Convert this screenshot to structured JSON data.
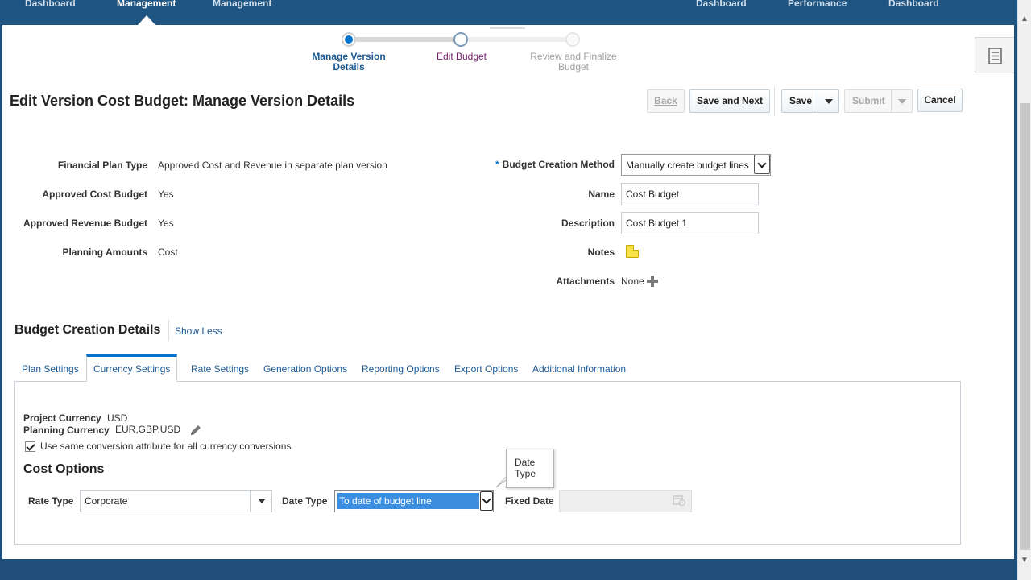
{
  "topnav": {
    "items": [
      "Dashboard",
      "Management",
      "Management",
      "Dashboard",
      "Performance",
      "Dashboard"
    ]
  },
  "train": {
    "stops": [
      {
        "label_line1": "Manage Version",
        "label_line2": "Details",
        "state": "current",
        "color": "#1c5a96"
      },
      {
        "label_line1": "Edit Budget",
        "label_line2": "",
        "state": "next",
        "color": "#7a1e6e"
      },
      {
        "label_line1": "Review and Finalize",
        "label_line2": "Budget",
        "state": "future",
        "color": "#a0a0a0"
      }
    ]
  },
  "page": {
    "title": "Edit Version Cost Budget: Manage Version Details"
  },
  "toolbar": {
    "back_label": "Back",
    "save_next_label": "Save and Next",
    "save_label": "Save",
    "submit_label": "Submit",
    "cancel_label": "Cancel"
  },
  "form_left": {
    "fields": [
      {
        "label": "Financial Plan Type",
        "value": "Approved Cost and Revenue in separate plan version"
      },
      {
        "label": "Approved Cost Budget",
        "value": "Yes"
      },
      {
        "label": "Approved Revenue Budget",
        "value": "Yes"
      },
      {
        "label": "Planning Amounts",
        "value": "Cost"
      }
    ]
  },
  "form_right": {
    "creation_method_label": "Budget Creation Method",
    "creation_method_required": "*",
    "creation_method_value": "Manually create budget lines",
    "name_label": "Name",
    "name_value": "Cost Budget",
    "description_label": "Description",
    "description_value": "Cost Budget 1",
    "notes_label": "Notes",
    "attachments_label": "Attachments",
    "attachments_value": "None"
  },
  "creation_details": {
    "title": "Budget Creation Details",
    "toggle_label": "Show Less",
    "tabs": [
      "Plan Settings",
      "Currency Settings",
      "Rate Settings",
      "Generation Options",
      "Reporting Options",
      "Export Options",
      "Additional Information"
    ],
    "active_tab": "Currency Settings"
  },
  "currency": {
    "project_currency_label": "Project Currency",
    "project_currency_value": "USD",
    "planning_currency_label": "Planning Currency",
    "planning_currency_value": "EUR,GBP,USD",
    "same_conversion_label": "Use same conversion attribute for all currency conversions",
    "same_conversion_checked": true
  },
  "cost_options": {
    "title": "Cost Options",
    "rate_type_label": "Rate Type",
    "rate_type_value": "Corporate",
    "date_type_label": "Date Type",
    "date_type_value": "To date of budget line",
    "fixed_date_label": "Fixed Date",
    "fixed_date_value": "",
    "tooltip_line1": "Date",
    "tooltip_line2": "Type"
  },
  "colors": {
    "nav_bg": "#1f5582",
    "accent": "#0572ce",
    "link": "#1c5a96",
    "highlight": "#3c8fe0"
  }
}
